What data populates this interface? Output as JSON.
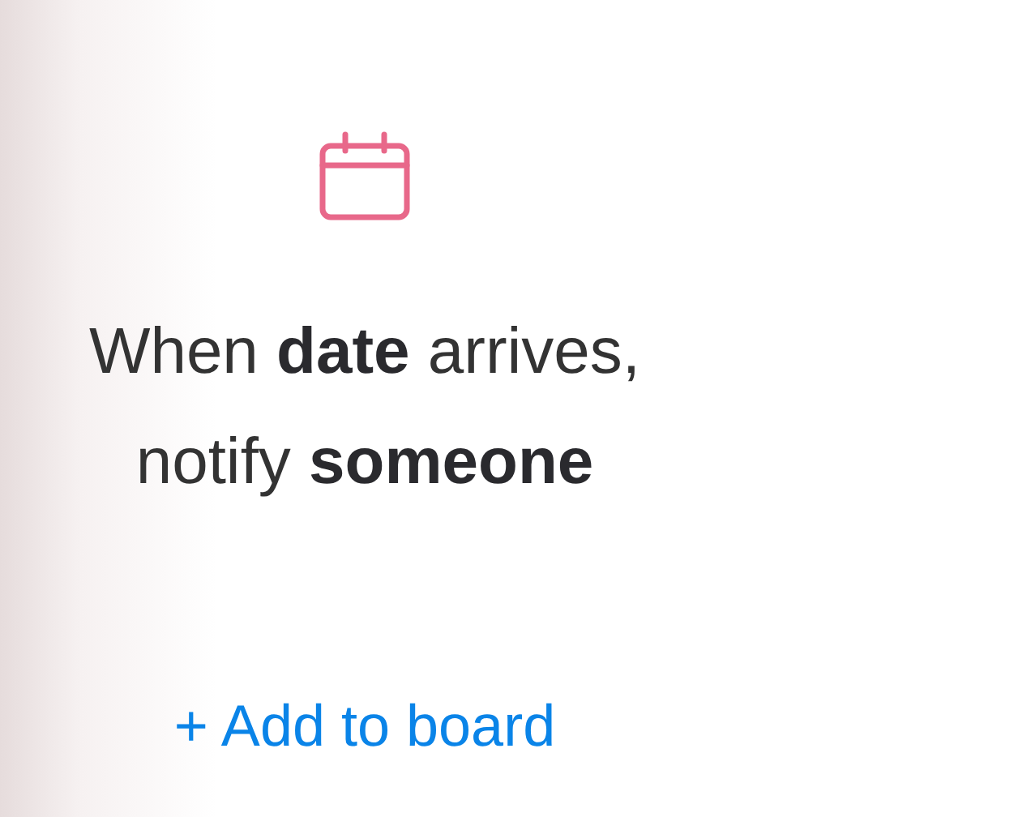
{
  "card": {
    "sentence": "When **date** arrives, notify **someone**",
    "link": "+ Add to board"
  }
}
